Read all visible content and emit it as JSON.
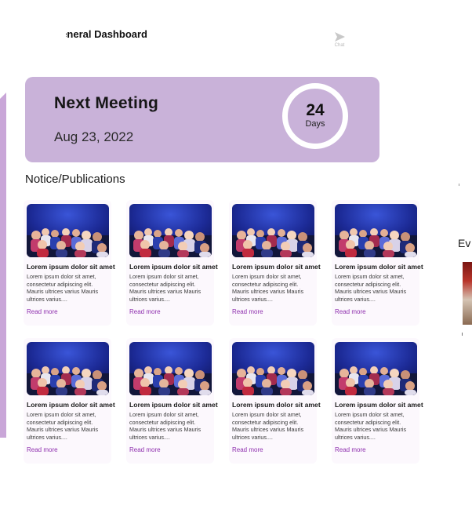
{
  "header": {
    "title": "General Dashboard"
  },
  "chat": {
    "label": "Chat",
    "icon": "send-icon"
  },
  "meeting": {
    "title": "Next Meeting",
    "date": "Aug 23, 2022",
    "days_count": "24",
    "days_label": "Days",
    "bg_color": "#c9b2d9"
  },
  "notices": {
    "section_title": "Notice/Publications",
    "items": [
      {
        "title": "Lorem ipsum dolor sit amet",
        "text": "Lorem ipsum dolor sit amet, consectetur adipiscing elit. Mauris ultrices varius Mauris ultrices varius....",
        "link": "Read more"
      },
      {
        "title": "Lorem ipsum dolor sit amet",
        "text": "Lorem ipsum dolor sit amet, consectetur adipiscing elit. Mauris ultrices varius Mauris ultrices varius....",
        "link": "Read more"
      },
      {
        "title": "Lorem ipsum dolor sit amet",
        "text": "Lorem ipsum dolor sit amet, consectetur adipiscing elit. Mauris ultrices varius Mauris ultrices varius....",
        "link": "Read more"
      },
      {
        "title": "Lorem ipsum dolor sit amet",
        "text": "Lorem ipsum dolor sit amet, consectetur adipiscing elit. Mauris ultrices varius Mauris ultrices varius....",
        "link": "Read more"
      },
      {
        "title": "Lorem ipsum dolor sit amet",
        "text": "Lorem ipsum dolor sit amet, consectetur adipiscing elit. Mauris ultrices varius Mauris ultrices varius....",
        "link": "Read more"
      },
      {
        "title": "Lorem ipsum dolor sit amet",
        "text": "Lorem ipsum dolor sit amet, consectetur adipiscing elit. Mauris ultrices varius Mauris ultrices varius....",
        "link": "Read more"
      },
      {
        "title": "Lorem ipsum dolor sit amet",
        "text": "Lorem ipsum dolor sit amet, consectetur adipiscing elit. Mauris ultrices varius Mauris ultrices varius....",
        "link": "Read more"
      },
      {
        "title": "Lorem ipsum dolor sit amet",
        "text": "Lorem ipsum dolor sit amet, consectetur adipiscing elit. Mauris ultrices varius Mauris ultrices varius....",
        "link": "Read more"
      }
    ]
  },
  "events": {
    "title": "Ev"
  },
  "colors": {
    "accent": "#c9b2d9",
    "link": "#8e2fae",
    "rail": "#c9a6d8"
  }
}
